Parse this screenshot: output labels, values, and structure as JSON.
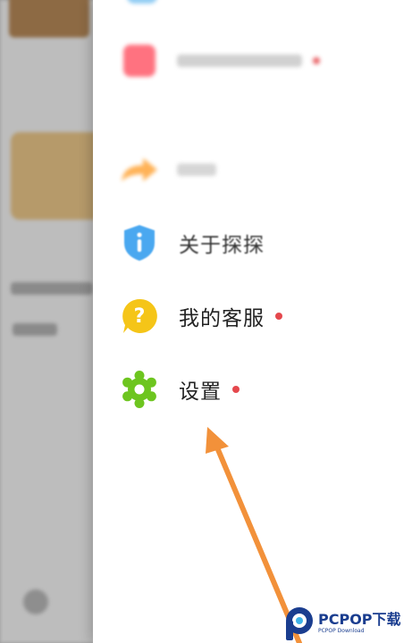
{
  "background": {
    "description_hidden": ""
  },
  "menu": {
    "items": [
      {
        "label": "",
        "icon": "square-icon",
        "color": "#ff5a6a",
        "dot": true
      },
      {
        "label": "",
        "icon": "share-icon",
        "color": "#ffa53a",
        "dot": false
      },
      {
        "label": "关于探探",
        "icon": "info-shield-icon",
        "color": "#4aa8f0",
        "dot": false
      },
      {
        "label": "我的客服",
        "icon": "help-bubble-icon",
        "color": "#f5c518",
        "dot": true
      },
      {
        "label": "设置",
        "icon": "gear-icon",
        "color": "#6dc51f",
        "dot": true
      }
    ]
  },
  "watermark": {
    "title": "PCPOP下载",
    "subtitle": "PCPOP Download"
  },
  "colors": {
    "accent_dot": "#e5484d",
    "arrow": "#f2913a",
    "watermark": "#1a3d8f"
  }
}
